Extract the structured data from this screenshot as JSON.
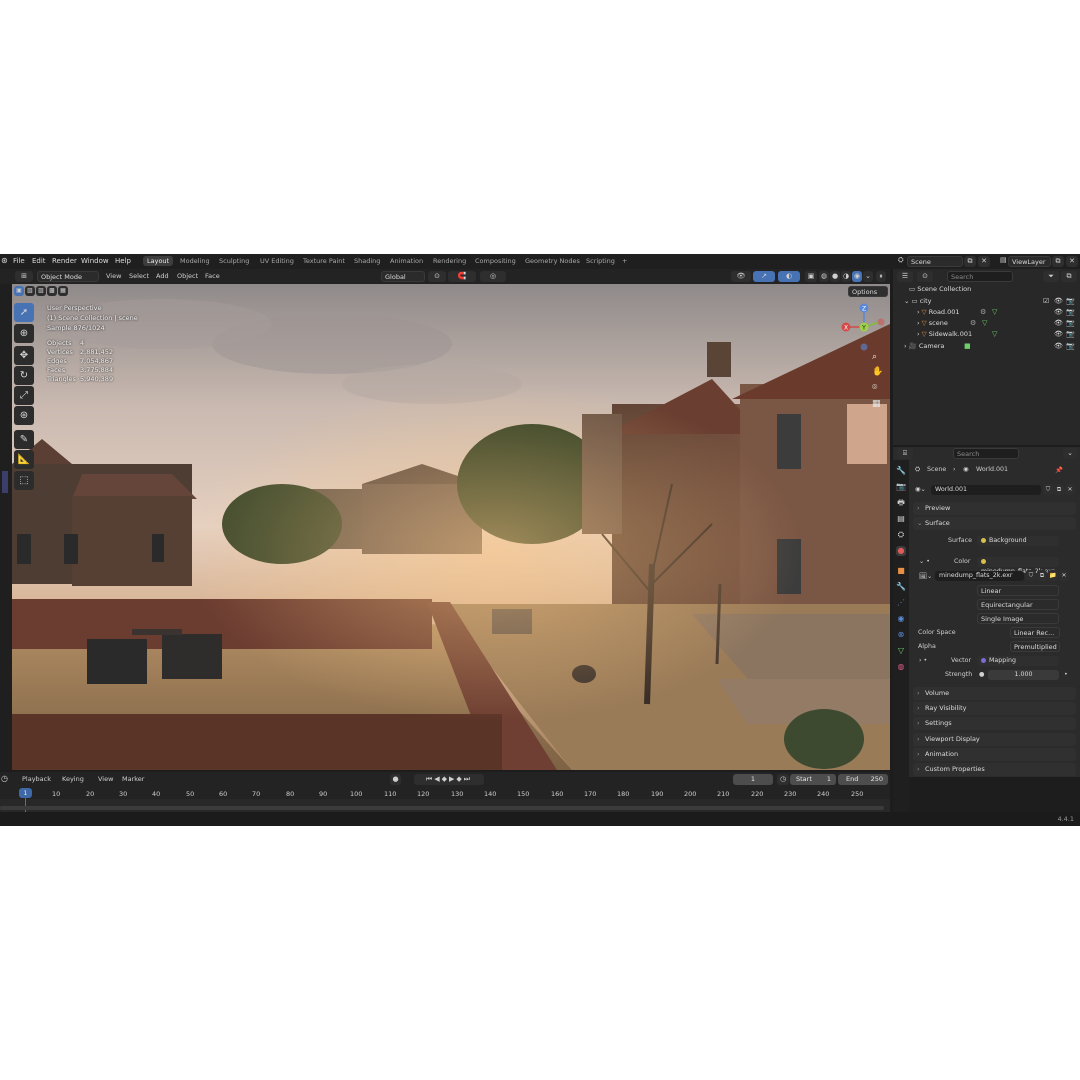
{
  "menu": [
    "File",
    "Edit",
    "Render",
    "Window",
    "Help"
  ],
  "workspaces": [
    "Layout",
    "Modeling",
    "Sculpting",
    "UV Editing",
    "Texture Paint",
    "Shading",
    "Animation",
    "Rendering",
    "Compositing",
    "Geometry Nodes",
    "Scripting"
  ],
  "workspace_add": "+",
  "scene_name": "Scene",
  "view_layer": "ViewLayer",
  "viewport_header": {
    "mode": "Object Mode",
    "menus": [
      "View",
      "Select",
      "Add",
      "Object",
      "Face"
    ],
    "transform": "Global",
    "options": "Options"
  },
  "viewport_overlay": {
    "title": "User Perspective",
    "collection": "(1) Scene Collection | scene",
    "sample": "Sample 876/1024",
    "stats": [
      {
        "label": "Objects",
        "value": "4"
      },
      {
        "label": "Vertices",
        "value": "2,881,452"
      },
      {
        "label": "Edges",
        "value": "7,054,867"
      },
      {
        "label": "Faces",
        "value": "3,775,884"
      },
      {
        "label": "Triangles",
        "value": "5,940,389"
      }
    ]
  },
  "gizmo": {
    "x": "X",
    "y": "Y",
    "z": "Z"
  },
  "outliner": {
    "search_placeholder": "Search",
    "root": "Scene Collection",
    "collection": "city",
    "items": [
      "Road.001",
      "scene",
      "Sidewalk.001"
    ],
    "camera": "Camera"
  },
  "properties": {
    "search_placeholder": "Search",
    "breadcrumb_scene": "Scene",
    "breadcrumb_world": "World.001",
    "world_name": "World.001",
    "panels_top": [
      "Preview",
      "Surface"
    ],
    "surface_label": "Surface",
    "surface_value": "Background",
    "color_label": "Color",
    "color_value": "minedump_flats_2k.exr",
    "image_name": "minedump_flats_2k.exr",
    "interpolation": "Linear",
    "projection": "Equirectangular",
    "source": "Single Image",
    "color_space_label": "Color Space",
    "color_space_value": "Linear Rec...",
    "alpha_label": "Alpha",
    "alpha_value": "Premultiplied",
    "vector_label": "Vector",
    "vector_value": "Mapping",
    "strength_label": "Strength",
    "strength_value": "1.000",
    "panels_bottom": [
      "Volume",
      "Ray Visibility",
      "Settings",
      "Viewport Display",
      "Animation",
      "Custom Properties"
    ]
  },
  "timeline": {
    "menus": [
      "Playback",
      "Keying",
      "View",
      "Marker"
    ],
    "current_frame": "1",
    "start_label": "Start",
    "start_value": "1",
    "end_label": "End",
    "end_value": "250",
    "ticks": [
      "1",
      "10",
      "20",
      "30",
      "40",
      "50",
      "60",
      "70",
      "80",
      "90",
      "100",
      "110",
      "120",
      "130",
      "140",
      "150",
      "160",
      "170",
      "180",
      "190",
      "200",
      "210",
      "220",
      "230",
      "240",
      "250"
    ]
  },
  "version": "4.4.1",
  "colors": {
    "accent": "#4772b3",
    "frame_current": "#3f68a8"
  }
}
